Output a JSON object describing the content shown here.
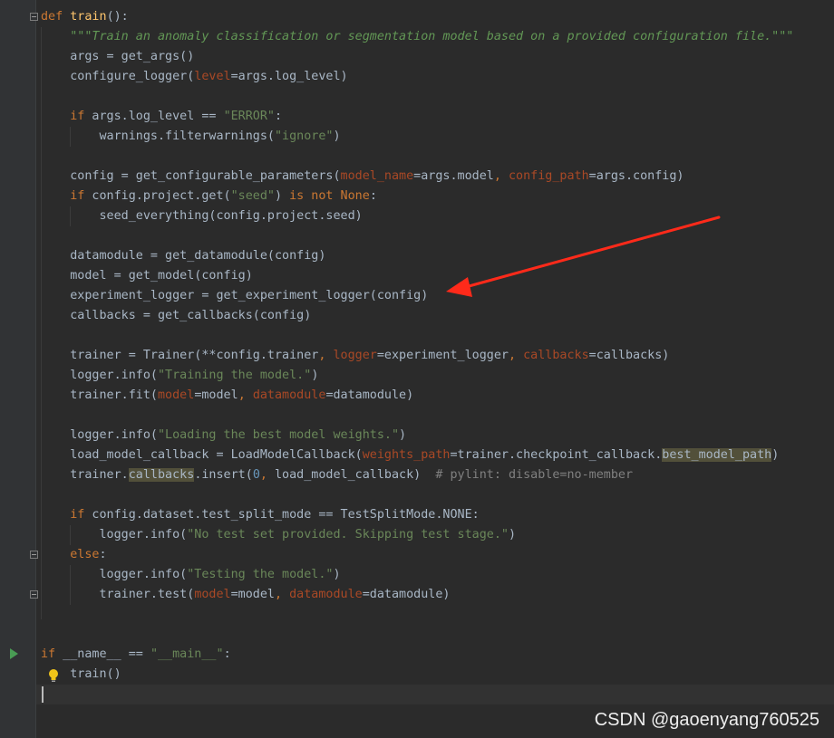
{
  "editor": {
    "lines": [
      {
        "kw1": "def",
        "fn": "train",
        "rest": "():"
      },
      {
        "doc": "\"\"\"Train an anomaly classification or segmentation model based on a provided configuration file.\"\"\""
      },
      {
        "text": "args = get_args()"
      },
      {
        "a": "configure_logger(",
        "p": "level",
        "b": "=args.log_level)"
      },
      {},
      {
        "kw": "if",
        "a": " args.log_level == ",
        "s": "\"ERROR\"",
        "b": ":"
      },
      {
        "a": "warnings.filterwarnings(",
        "s": "\"ignore\"",
        "b": ")"
      },
      {},
      {
        "a": "config = get_configurable_parameters(",
        "p1": "model_name",
        "b": "=args.model",
        "c": ", ",
        "p2": "config_path",
        "d": "=args.config)"
      },
      {
        "kw": "if",
        "a": " config.project.get(",
        "s": "\"seed\"",
        "b": ") ",
        "kw2": "is not None",
        "c": ":"
      },
      {
        "text": "seed_everything(config.project.seed)"
      },
      {},
      {
        "text": "datamodule = get_datamodule(config)"
      },
      {
        "text": "model = get_model(config)"
      },
      {
        "text": "experiment_logger = get_experiment_logger(config)"
      },
      {
        "text": "callbacks = get_callbacks(config)"
      },
      {},
      {
        "a": "trainer = Trainer(**config.trainer",
        "c1": ", ",
        "p1": "logger",
        "b": "=experiment_logger",
        "c2": ", ",
        "p2": "callbacks",
        "d": "=callbacks)"
      },
      {
        "a": "logger.info(",
        "s": "\"Training the model.\"",
        "b": ")"
      },
      {
        "a": "trainer.fit(",
        "p1": "model",
        "b": "=model",
        "c": ", ",
        "p2": "datamodule",
        "d": "=datamodule)"
      },
      {},
      {
        "a": "logger.info(",
        "s": "\"Loading the best model weights.\"",
        "b": ")"
      },
      {
        "a": "load_model_callback = LoadModelCallback(",
        "p": "weights_path",
        "b": "=trainer.checkpoint_callback.",
        "h": "best_model_path",
        "c": ")"
      },
      {
        "a": "trainer.",
        "h": "callbacks",
        "b": ".insert(",
        "n": "0",
        "c": ", ",
        "d": "load_model_callback)  ",
        "cm": "# pylint: disable=no-member"
      },
      {},
      {
        "kw": "if",
        "a": " config.dataset.test_split_mode == TestSplitMode.NONE:"
      },
      {
        "a": "logger.info(",
        "s": "\"No test set provided. Skipping test stage.\"",
        "b": ")"
      },
      {
        "kw": "else",
        "a": ":"
      },
      {
        "a": "logger.info(",
        "s": "\"Testing the model.\"",
        "b": ")"
      },
      {
        "a": "trainer.test(",
        "p1": "model",
        "b": "=model",
        "c": ", ",
        "p2": "datamodule",
        "d": "=datamodule)"
      },
      {},
      {},
      {
        "kw": "if",
        "a": " __name__ == ",
        "s": "\"__main__\"",
        "b": ":"
      },
      {
        "text": "train()"
      },
      {}
    ]
  },
  "watermark": "CSDN @gaoenyang760525",
  "colors": {
    "background": "#2b2b2b",
    "keyword": "#cc7832",
    "function": "#ffc66d",
    "string": "#6a8759",
    "param": "#aa4926",
    "arrow": "#ff2a1a"
  }
}
